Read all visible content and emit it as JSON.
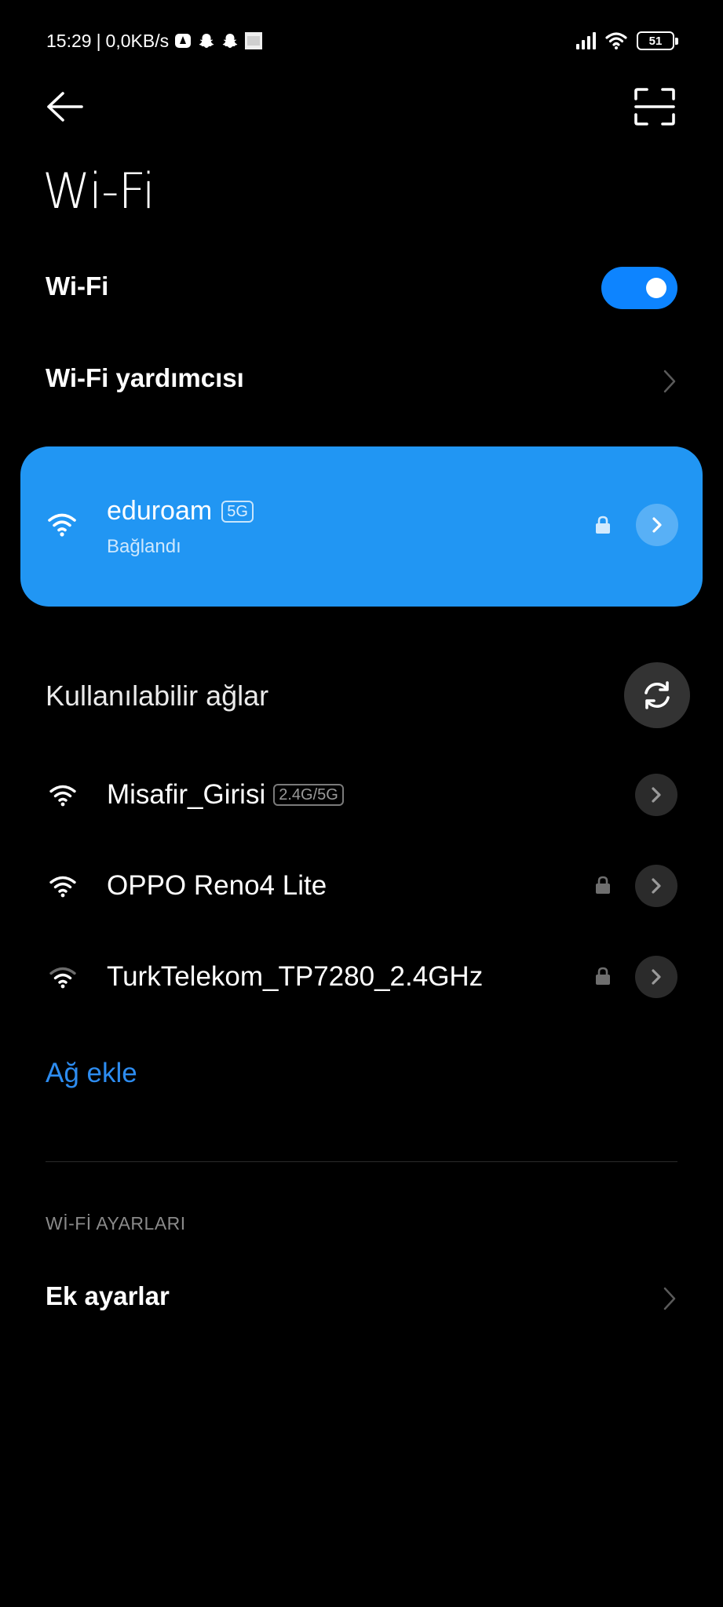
{
  "status_bar": {
    "time": "15:29",
    "separator": "|",
    "speed": "0,0KB/s",
    "battery": "51",
    "icons": [
      "notification-app-icon",
      "snapchat-icon",
      "snapchat-icon",
      "image-notification-icon",
      "cell-signal-icon",
      "wifi-signal-icon",
      "battery-icon"
    ]
  },
  "header": {
    "title": "Wi-Fi",
    "back_icon": "back-arrow-icon",
    "scan_icon": "qr-scan-icon"
  },
  "wifi_toggle": {
    "label": "Wi-Fi",
    "on": true
  },
  "assistant": {
    "label": "Wi-Fi yardımcısı"
  },
  "connected": {
    "ssid": "eduroam",
    "band": "5G",
    "status": "Bağlandı",
    "secured": true
  },
  "available": {
    "title": "Kullanılabilir ağlar",
    "networks": [
      {
        "ssid": "Misafir_Girisi",
        "band": "2.4G/5G",
        "secured": false
      },
      {
        "ssid": "OPPO Reno4 Lite",
        "band": "",
        "secured": true
      },
      {
        "ssid": "TurkTelekom_TP7280_2.4GHz",
        "band": "",
        "secured": true
      }
    ]
  },
  "add_network": {
    "label": "Ağ ekle"
  },
  "settings_section": {
    "header": "Wİ-Fİ AYARLARI",
    "items": [
      {
        "label": "Ek ayarlar"
      }
    ]
  },
  "colors": {
    "accent": "#0d84ff",
    "card": "#2196f3",
    "link": "#2d8cf0",
    "background": "#000000"
  }
}
